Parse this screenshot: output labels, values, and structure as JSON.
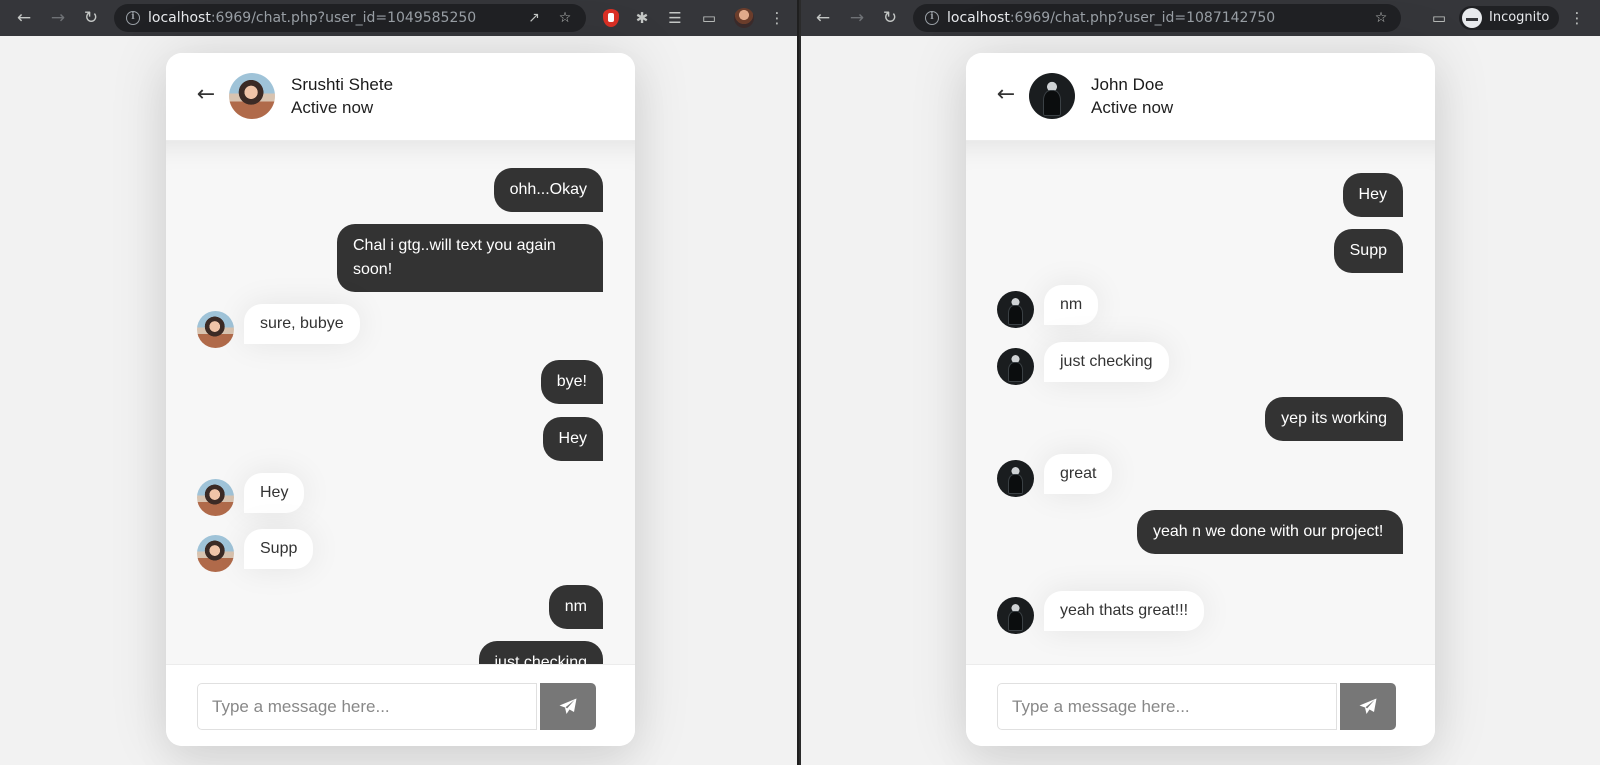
{
  "windows": [
    {
      "url": {
        "host": "localhost",
        "rest": ":6969/chat.php?user_id=1049585250"
      },
      "profile": "avatar",
      "contact": {
        "name": "Srushti Shete",
        "status": "Active now",
        "avatar": "avatar-girl"
      },
      "input_placeholder": "Type a message here...",
      "messages": [
        {
          "dir": "out",
          "text": "ohh...Okay"
        },
        {
          "dir": "out",
          "text": "Chal i gtg..will text you again soon!"
        },
        {
          "dir": "in",
          "text": "sure, bubye"
        },
        {
          "dir": "out",
          "text": "bye!"
        },
        {
          "dir": "out",
          "text": "Hey"
        },
        {
          "dir": "in",
          "text": "Hey"
        },
        {
          "dir": "in",
          "text": "Supp"
        },
        {
          "dir": "out",
          "text": "nm"
        },
        {
          "dir": "out",
          "text": "just checking"
        }
      ]
    },
    {
      "url": {
        "host": "localhost",
        "rest": ":6969/chat.php?user_id=1087142750"
      },
      "incognito_label": "Incognito",
      "contact": {
        "name": "John Doe",
        "status": "Active now",
        "avatar": "avatar-man"
      },
      "input_placeholder": "Type a message here...",
      "messages": [
        {
          "dir": "out",
          "text": "Hey"
        },
        {
          "dir": "out",
          "text": "Supp"
        },
        {
          "dir": "in",
          "text": "nm"
        },
        {
          "dir": "in",
          "text": "just checking"
        },
        {
          "dir": "out",
          "text": "yep its working"
        },
        {
          "dir": "in",
          "text": "great"
        },
        {
          "dir": "out",
          "text": "yeah n we done with our project!"
        },
        {
          "dir": "in",
          "text": "yeah thats great!!!"
        }
      ]
    }
  ],
  "icons": {
    "back": "arrow-left-icon",
    "forward": "arrow-right-icon",
    "reload": "reload-icon",
    "send": "paper-plane-icon"
  },
  "colors": {
    "outgoing_bubble": "#333333",
    "send_button": "#777777",
    "browser_toolbar": "#35363a"
  }
}
